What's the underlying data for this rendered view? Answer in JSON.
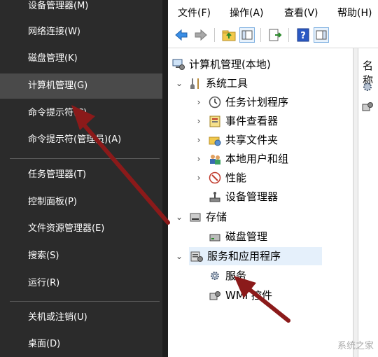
{
  "winx_menu": {
    "items": [
      {
        "label": "设备管理器(M)"
      },
      {
        "label": "网络连接(W)"
      },
      {
        "label": "磁盘管理(K)"
      },
      {
        "label": "计算机管理(G)"
      },
      {
        "label": "命令提示符(C)"
      },
      {
        "label": "命令提示符(管理员)(A)"
      },
      {
        "label": "任务管理器(T)"
      },
      {
        "label": "控制面板(P)"
      },
      {
        "label": "文件资源管理器(E)"
      },
      {
        "label": "搜索(S)"
      },
      {
        "label": "运行(R)"
      },
      {
        "label": "关机或注销(U)"
      },
      {
        "label": "桌面(D)"
      }
    ],
    "selected": "计算机管理(G)"
  },
  "mmc": {
    "menus": [
      "文件(F)",
      "操作(A)",
      "查看(V)",
      "帮助(H)"
    ],
    "toolbar_icons": [
      "back-arrow-icon",
      "forward-arrow-icon",
      "up-folder-icon",
      "show-hide-tree-icon",
      "export-list-icon",
      "help-icon",
      "action-pane-icon"
    ],
    "tree": [
      {
        "label": "计算机管理(本地)",
        "icon": "computer-management-icon"
      },
      {
        "label": "系统工具",
        "icon": "tools-icon"
      },
      {
        "label": "任务计划程序",
        "icon": "clock-icon"
      },
      {
        "label": "事件查看器",
        "icon": "event-viewer-icon"
      },
      {
        "label": "共享文件夹",
        "icon": "shared-folder-icon"
      },
      {
        "label": "本地用户和组",
        "icon": "users-icon"
      },
      {
        "label": "性能",
        "icon": "performance-icon"
      },
      {
        "label": "设备管理器",
        "icon": "device-manager-icon"
      },
      {
        "label": "存储",
        "icon": "storage-icon"
      },
      {
        "label": "磁盘管理",
        "icon": "disk-icon"
      },
      {
        "label": "服务和应用程序",
        "icon": "services-apps-icon"
      },
      {
        "label": "服务",
        "icon": "gear-icon"
      },
      {
        "label": "WMI 控件",
        "icon": "wmi-icon"
      }
    ],
    "right_pane_header": "名称"
  },
  "watermark": "系统之家",
  "colors": {
    "menu_bg": "#2b2b2b",
    "menu_selected": "#4a4a4a",
    "arrow": "#8b1a1a",
    "tree_highlight": "#e5f0fb"
  }
}
